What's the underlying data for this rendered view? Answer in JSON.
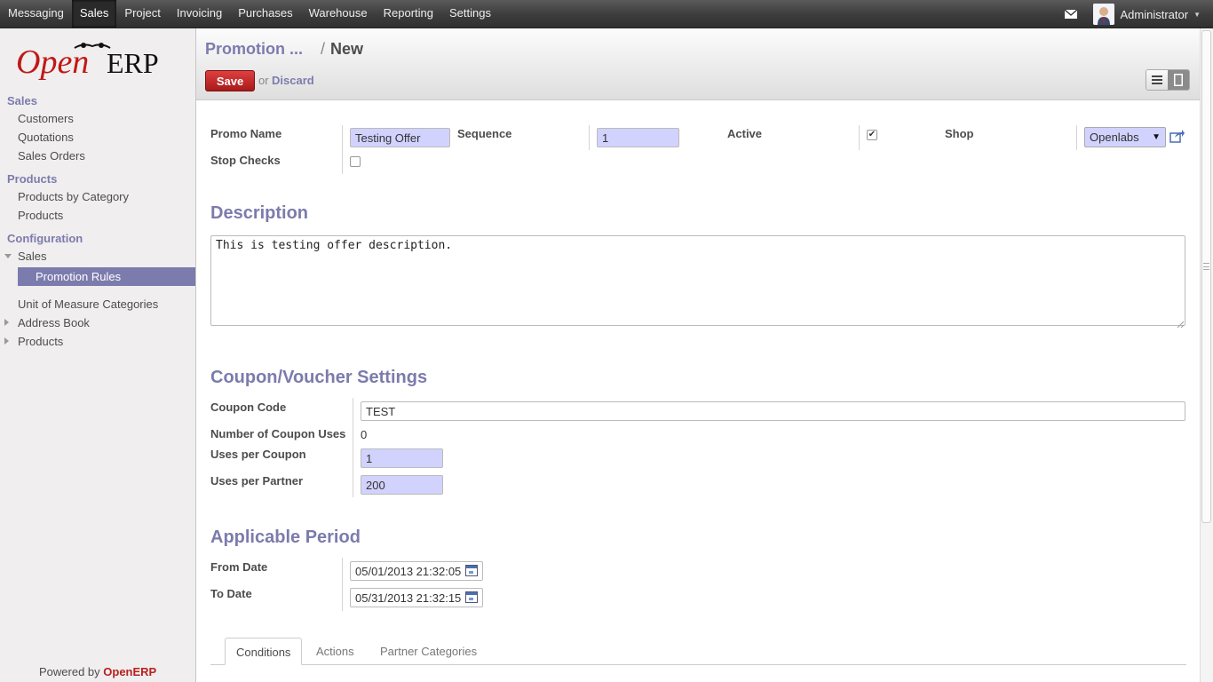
{
  "topmenu": {
    "items": [
      "Messaging",
      "Sales",
      "Project",
      "Invoicing",
      "Purchases",
      "Warehouse",
      "Reporting",
      "Settings"
    ],
    "active": "Sales",
    "user": "Administrator",
    "icons": {
      "messages": "mail-icon",
      "user": "avatar",
      "dropdown": "caret-down-icon"
    }
  },
  "sidebar": {
    "logo": {
      "part1": "Open",
      "part2": "ERP"
    },
    "sales_head": "Sales",
    "customers": "Customers",
    "quotations": "Quotations",
    "sales_orders": "Sales Orders",
    "products_head": "Products",
    "products_by_category": "Products by Category",
    "products": "Products",
    "config_head": "Configuration",
    "config_sales": "Sales",
    "promotion_rules": "Promotion Rules",
    "uom_categories": "Unit of Measure Categories",
    "address_book": "Address Book",
    "config_products": "Products",
    "powered_prefix": "Powered by ",
    "powered_brand": "OpenERP"
  },
  "header": {
    "breadcrumb_parent": "Promotion ...",
    "breadcrumb_sep": "/",
    "breadcrumb_current": "New",
    "save_label": "Save",
    "or_text": "or",
    "discard_label": "Discard"
  },
  "form": {
    "promo_name_label": "Promo Name",
    "promo_name_value": "Testing Offer",
    "sequence_label": "Sequence",
    "sequence_value": "1",
    "active_label": "Active",
    "active_checked": true,
    "shop_label": "Shop",
    "shop_value": "Openlabs",
    "stop_checks_label": "Stop Checks",
    "stop_checks_checked": false,
    "description_heading": "Description",
    "description_value": "This is testing offer description.",
    "coupon_heading": "Coupon/Voucher Settings",
    "coupon_code_label": "Coupon Code",
    "coupon_code_value": "TEST",
    "coupon_uses_label": "Number of Coupon Uses",
    "coupon_uses_value": "0",
    "uses_per_coupon_label": "Uses per Coupon",
    "uses_per_coupon_value": "1",
    "uses_per_partner_label": "Uses per Partner",
    "uses_per_partner_value": "200",
    "period_heading": "Applicable Period",
    "from_date_label": "From Date",
    "from_date_value": "05/01/2013 21:32:05",
    "to_date_label": "To Date",
    "to_date_value": "05/31/2013 21:32:15"
  },
  "tabs": [
    "Conditions",
    "Actions",
    "Partner Categories"
  ],
  "active_tab": "Conditions",
  "colors": {
    "accent": "#7c7bad",
    "save": "#c42b2b",
    "required_bg": "#d2d2ff",
    "brand": "#b92020"
  }
}
